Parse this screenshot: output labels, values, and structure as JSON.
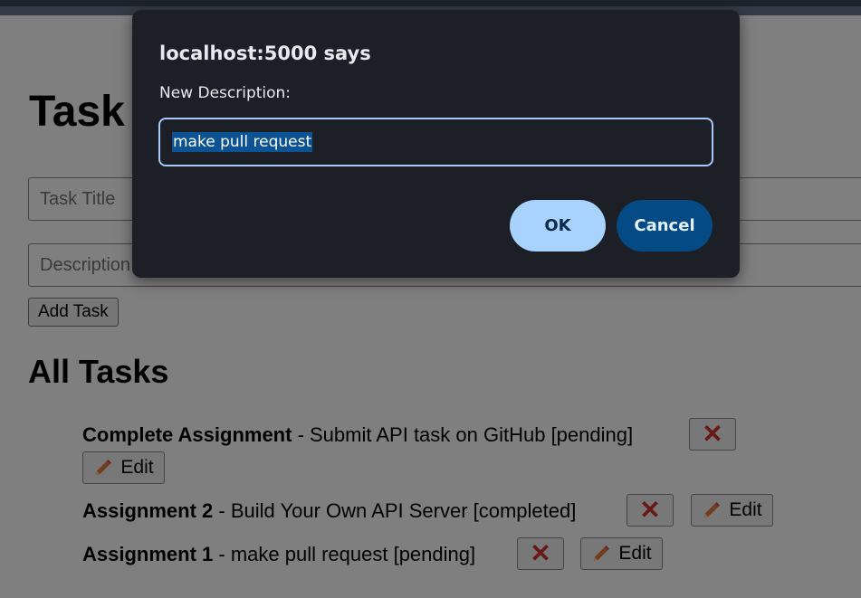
{
  "page": {
    "title": "Task Manager",
    "title_input_placeholder": "Task Title",
    "description_input_placeholder": "Description",
    "add_button": "Add Task",
    "all_tasks_heading": "All Tasks",
    "tasks": [
      {
        "title": "Complete Assignment",
        "rest": " - Submit API task on GitHub [pending]",
        "delete_glyph": "✕",
        "edit_label": "Edit"
      },
      {
        "title": "Assignment 2",
        "rest": " - Build Your Own API Server [completed]",
        "delete_glyph": "✕",
        "edit_label": "Edit"
      },
      {
        "title": "Assignment 1",
        "rest": " - make pull request [pending]",
        "delete_glyph": "✕",
        "edit_label": "Edit"
      }
    ]
  },
  "dialog": {
    "title": "localhost:5000 says",
    "message": "New Description:",
    "input_value": "make pull request",
    "ok_label": "OK",
    "cancel_label": "Cancel"
  },
  "colors": {
    "dialog_bg": "#1c1f26",
    "ok_bg": "#a8d3ff",
    "cancel_bg": "#044a85",
    "delete_icon": "#d0302f"
  }
}
